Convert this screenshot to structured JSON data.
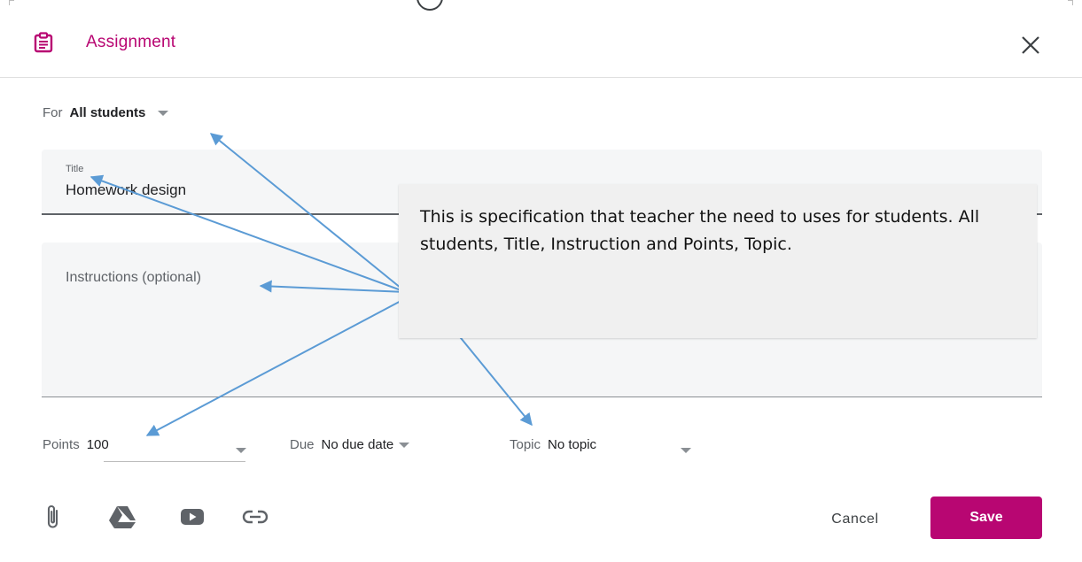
{
  "dialog": {
    "title": "Assignment",
    "icon": "assignment-icon",
    "close_icon": "close-icon",
    "accent_color": "#b80672"
  },
  "assign_to": {
    "label": "For",
    "value": "All students"
  },
  "title_field": {
    "label": "Title",
    "value": "Homework design"
  },
  "instructions_field": {
    "placeholder": "Instructions (optional)"
  },
  "points": {
    "label": "Points",
    "value": "100"
  },
  "due": {
    "label": "Due",
    "value": "No due date"
  },
  "topic": {
    "label": "Topic",
    "value": "No topic"
  },
  "attachments": {
    "icons": [
      "attach-file-icon",
      "google-drive-icon",
      "youtube-icon",
      "link-icon"
    ]
  },
  "actions": {
    "cancel_label": "Cancel",
    "save_label": "Save"
  },
  "annotation": {
    "text": "This is specification that teacher the need to uses for students. All students, Title, Instruction and Points, Topic.",
    "arrow_color": "#5b9bd5"
  }
}
